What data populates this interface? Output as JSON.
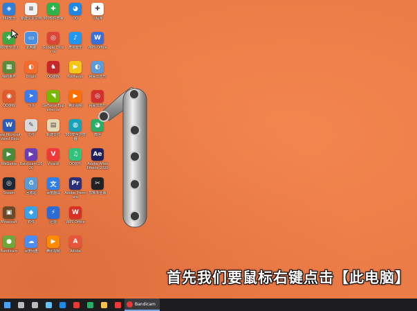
{
  "desktop": {
    "background_color": "#ec7c47",
    "icons": [
      {
        "label": "360安全",
        "color": "#2f7ed8",
        "glyph": "◈"
      },
      {
        "label": "360安全卫士",
        "color": "#3da844",
        "glyph": "✚"
      },
      {
        "label": "我的世界",
        "color": "#5b8a3a",
        "glyph": "▦"
      },
      {
        "label": "QQ游戏",
        "color": "#e05a2b",
        "glyph": "◉"
      },
      {
        "label": "New Microsoft Word Document",
        "color": "#2b5cb8",
        "glyph": "W"
      },
      {
        "label": "WeGame",
        "color": "#4a8a3a",
        "glyph": "▶"
      },
      {
        "label": "Steam",
        "color": "#1b2838",
        "glyph": "◎"
      },
      {
        "label": "Minecraft",
        "color": "#6b4a2a",
        "glyph": "▣"
      },
      {
        "label": "Bandicam",
        "color": "#6fa83a",
        "glyph": "●"
      },
      {
        "label": "新建文本文档",
        "color": "#f2f2f2",
        "glyph": "≡"
      },
      {
        "label": "此电脑",
        "color": "#4a90e2",
        "glyph": "▭"
      },
      {
        "label": "Origin",
        "color": "#f56c2d",
        "glyph": "◐"
      },
      {
        "label": "飞书",
        "color": "#3c7af0",
        "glyph": "➤"
      },
      {
        "label": "文件",
        "color": "#d9d9d9",
        "glyph": "✎"
      },
      {
        "label": "Bandicam 2020",
        "color": "#6a3fb5",
        "glyph": "▶"
      },
      {
        "label": "回收站",
        "color": "#5b9bd5",
        "glyph": "♻"
      },
      {
        "label": "软件",
        "color": "#3aa0e8",
        "glyph": "◆"
      },
      {
        "label": "百度网盘",
        "color": "#4b8df8",
        "glyph": "☁"
      },
      {
        "label": "360软件管家",
        "color": "#2eb24a",
        "glyph": "✚"
      },
      {
        "label": "Google Chrome",
        "color": "#db4437",
        "glyph": "◎"
      },
      {
        "label": "QQ游戏",
        "color": "#c62828",
        "glyph": "♞"
      },
      {
        "label": "GeForce Experience",
        "color": "#76b900",
        "glyph": "◥"
      },
      {
        "label": "新建文件",
        "color": "#e8d9b5",
        "glyph": "▤"
      },
      {
        "label": "Vivaldi",
        "color": "#ef3939",
        "glyph": "V"
      },
      {
        "label": "百度翻译",
        "color": "#2f7fe8",
        "glyph": "文"
      },
      {
        "label": "迅雷",
        "color": "#2b6cd4",
        "glyph": "⚡"
      },
      {
        "label": "腾讯视频",
        "color": "#ff8a00",
        "glyph": "▶"
      },
      {
        "label": "QQ",
        "color": "#1e88e5",
        "glyph": "◕"
      },
      {
        "label": "酷狗音乐",
        "color": "#2196f3",
        "glyph": "♪"
      },
      {
        "label": "PotPlayer",
        "color": "#f5c518",
        "glyph": "▶"
      },
      {
        "label": "腾讯视频",
        "color": "#ff6f00",
        "glyph": "▶"
      },
      {
        "label": "360安全浏览器",
        "color": "#17a2b8",
        "glyph": "◍"
      },
      {
        "label": "QQ音乐",
        "color": "#31c27c",
        "glyph": "♫"
      },
      {
        "label": "Adobe Premiere",
        "color": "#2a2f7a",
        "glyph": "Pr"
      },
      {
        "label": "WPS Office",
        "color": "#d93025",
        "glyph": "W"
      },
      {
        "label": "Adobe",
        "color": "#e8553a",
        "glyph": "A"
      },
      {
        "label": "小程序",
        "color": "#ffffff",
        "glyph": "✚"
      },
      {
        "label": "WPS Office",
        "color": "#3b6fd8",
        "glyph": "W"
      },
      {
        "label": "网易云音乐",
        "color": "#5a9bd8",
        "glyph": "◐"
      },
      {
        "label": "网易云音乐",
        "color": "#d32f2f",
        "glyph": "◎"
      },
      {
        "label": "微信",
        "color": "#2aae67",
        "glyph": "◕"
      },
      {
        "label": "Adobe After Effects 2020",
        "color": "#1f1f5e",
        "glyph": "Ae"
      },
      {
        "label": "剪映专业版",
        "color": "#222222",
        "glyph": "✂"
      }
    ]
  },
  "subtitle": "首先我们要鼠标右键点击【此电脑】",
  "taskbar": {
    "background_color": "#1d1d20",
    "pinned": [
      {
        "name": "windows-start-icon",
        "color": "#4aa3f0"
      },
      {
        "name": "search-icon",
        "color": "#bbbbbb"
      },
      {
        "name": "task-view-icon",
        "color": "#bbbbbb"
      },
      {
        "name": "steam-icon",
        "color": "#66c0f4"
      },
      {
        "name": "qq-icon",
        "color": "#1e88e5"
      },
      {
        "name": "netease-music-icon",
        "color": "#e53935"
      },
      {
        "name": "wechat-icon",
        "color": "#2aae67"
      },
      {
        "name": "folder-icon",
        "color": "#f4c04e"
      },
      {
        "name": "vivaldi-icon",
        "color": "#ef3939"
      }
    ],
    "active_app": {
      "label": "Bandicam",
      "color": "#e53935"
    }
  }
}
